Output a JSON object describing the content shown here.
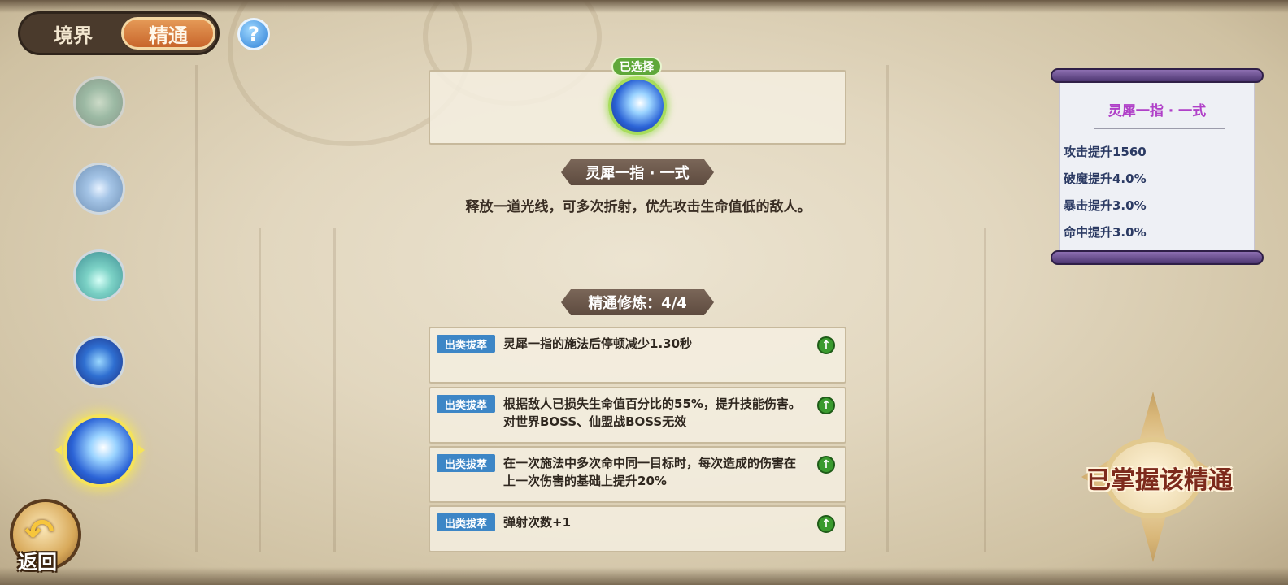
{
  "tabs": {
    "realm_label": "境界",
    "mastery_label": "精通",
    "active": "精通"
  },
  "help": {
    "label": "?"
  },
  "skills_list": [
    {
      "name": "skill-1",
      "selected": false
    },
    {
      "name": "skill-2",
      "selected": false
    },
    {
      "name": "skill-3",
      "selected": false
    },
    {
      "name": "skill-4",
      "selected": false
    },
    {
      "name": "skill-5",
      "selected": true
    }
  ],
  "back_button": {
    "label": "返回",
    "icon": "return-arrow-icon"
  },
  "selected_skill": {
    "badge": "已选择",
    "name": "灵犀一指 · 一式",
    "description": "释放一道光线，可多次折射，优先攻击生命值低的敌人。"
  },
  "mastery": {
    "title": "精通修炼：4/4",
    "rows": [
      {
        "tag": "出类拔萃",
        "text": "灵犀一指的施法后停顿减少1.30秒"
      },
      {
        "tag": "出类拔萃",
        "text": "根据敌人已损失生命值百分比的55%，提升技能伤害。对世界BOSS、仙盟战BOSS无效"
      },
      {
        "tag": "出类拔萃",
        "text": "在一次施法中多次命中同一目标时，每次造成的伤害在上一次伤害的基础上提升20%"
      },
      {
        "tag": "出类拔萃",
        "text": "弹射次数+1"
      }
    ],
    "row_icon": "upgrade-arrow-icon"
  },
  "stats_scroll": {
    "title": "灵犀一指 · 一式",
    "stats": [
      "攻击提升1560",
      "破魔提升4.0%",
      "暴击提升3.0%",
      "命中提升3.0%"
    ]
  },
  "emblem": {
    "text": "已掌握该精通"
  },
  "colors": {
    "tag_blue": "#3d86c6",
    "selected_green": "#5fa83a",
    "scroll_title_purple": "#b040c8",
    "emblem_red": "#7d2a1c"
  }
}
